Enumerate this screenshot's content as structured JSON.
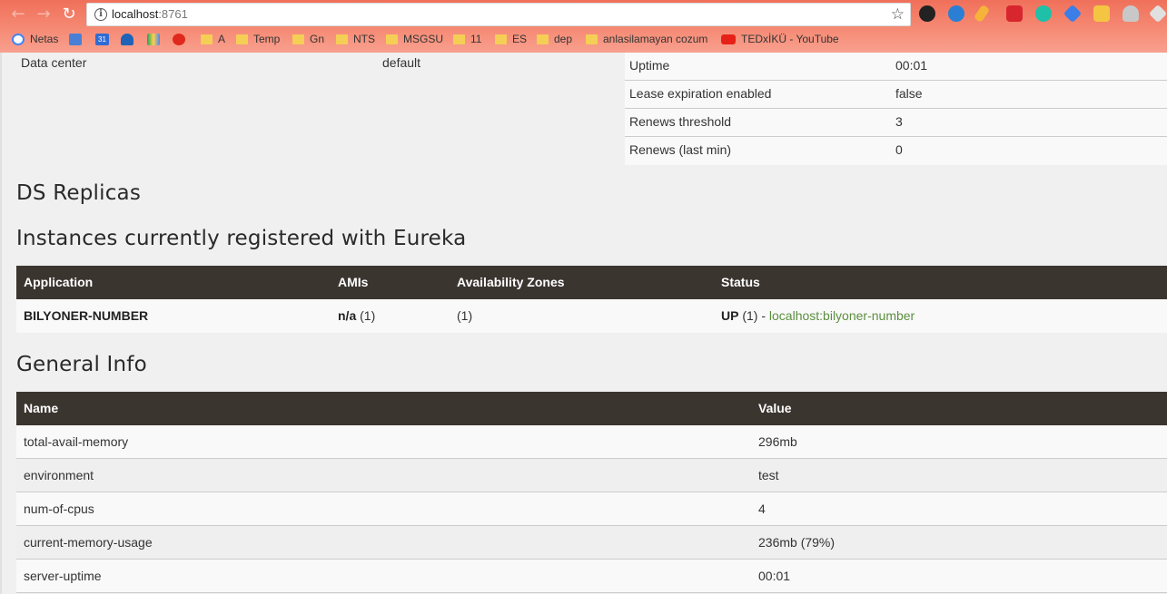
{
  "browser": {
    "url_host": "localhost",
    "url_port": ":8761",
    "bookmarks": [
      "Netas",
      "A",
      "Temp",
      "Gn",
      "NTS",
      "MSGSU",
      "11",
      "ES",
      "dep",
      "anlasilamayan cozum",
      "TEDxİKÜ - YouTube"
    ],
    "calendar_day": "31"
  },
  "env_table": {
    "rows": [
      {
        "label": "Data center",
        "value": "default"
      }
    ]
  },
  "status_table": {
    "rows": [
      {
        "label": "Uptime",
        "value": "00:01"
      },
      {
        "label": "Lease expiration enabled",
        "value": "false"
      },
      {
        "label": "Renews threshold",
        "value": "3"
      },
      {
        "label": "Renews (last min)",
        "value": "0"
      }
    ]
  },
  "sections": {
    "ds_replicas": "DS Replicas",
    "instances": "Instances currently registered with Eureka",
    "general_info": "General Info"
  },
  "instances_table": {
    "headers": [
      "Application",
      "AMIs",
      "Availability Zones",
      "Status"
    ],
    "rows": [
      {
        "application": "BILYONER-NUMBER",
        "amis_bold": "n/a",
        "amis_count": " (1)",
        "zones": "(1)",
        "status_bold": "UP",
        "status_count": " (1) - ",
        "status_link": "localhost:bilyoner-number"
      }
    ]
  },
  "info_table": {
    "headers": [
      "Name",
      "Value"
    ],
    "rows": [
      {
        "name": "total-avail-memory",
        "value": "296mb"
      },
      {
        "name": "environment",
        "value": "test"
      },
      {
        "name": "num-of-cpus",
        "value": "4"
      },
      {
        "name": "current-memory-usage",
        "value": "236mb (79%)"
      },
      {
        "name": "server-uptime",
        "value": "00:01"
      }
    ]
  },
  "colors": {
    "chrome_top": "#f0705a",
    "table_header": "#3b3530",
    "link": "#5c8f3f"
  }
}
